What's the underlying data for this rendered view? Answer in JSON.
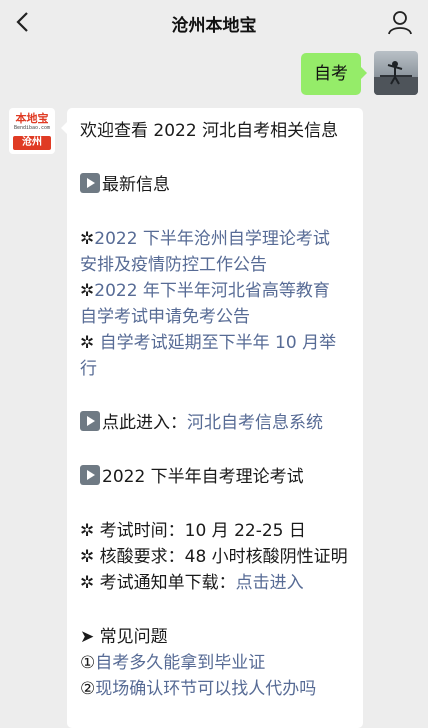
{
  "header": {
    "title": "沧州本地宝"
  },
  "icons": {
    "back": "chevron-left-icon",
    "profile": "person-icon"
  },
  "outgoing": {
    "text": "自考"
  },
  "bot": {
    "logo_text": "本地宝",
    "logo_sub": "Bendibao.com",
    "logo_city": "沧州"
  },
  "message": {
    "greeting": "欢迎查看 2022 河北自考相关信息",
    "sec1_title": "最新信息",
    "item1_l1_star": "✲",
    "item1_l1": "2022 下半年沧州自学理论考试",
    "item1_l2": "安排及疫情防控工作公告",
    "item2_l1_star": "✲",
    "item2_l1": "2022 年下半年河北省高等教育",
    "item2_l2": "自学考试申请免考公告",
    "item3_l1_star": "✲ ",
    "item3_l1": "自学考试延期至下半年 10 月举",
    "item3_l2": "行",
    "enter_prefix": "点此进入：",
    "enter_link": "河北自考信息系统",
    "sec2_title": "2022 下半年自考理论考试",
    "exam_time": "✲ 考试时间：10 月 22-25 日",
    "acid_req": "✲ 核酸要求：48 小时核酸阴性证明",
    "notice_prefix": "✲ 考试通知单下载：",
    "notice_link": "点击进入",
    "faq_title": "➤ 常见问题",
    "faq1_num": "①",
    "faq1": "自考多久能拿到毕业证",
    "faq2_num": "②",
    "faq2": "现场确认环节可以找人代办吗"
  }
}
